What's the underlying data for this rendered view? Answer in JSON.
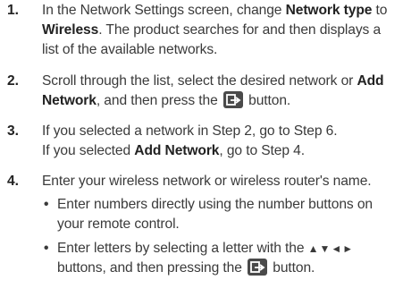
{
  "steps": [
    {
      "num": "1.",
      "p1": "In the Network Settings screen, change ",
      "b1": "Network type",
      "p2": " to ",
      "b2": "Wireless",
      "p3": ". The product searches for and then displays a list of the available networks."
    },
    {
      "num": "2.",
      "p1": "Scroll through the list, select the desired network or ",
      "b1": "Add Network",
      "p2": ", and then press the",
      "p3": "button."
    },
    {
      "num": "3.",
      "line1": "If you selected a network in Step 2, go to Step 6.",
      "p1": "If you selected ",
      "b1": "Add Network",
      "p2": ", go to Step 4."
    },
    {
      "num": "4.",
      "p1": "Enter your wireless network or wireless router's name.",
      "bullet1": "Enter numbers directly using the number buttons on your remote control.",
      "bullet2_a": "Enter letters by selecting a letter with the",
      "bullet2_arrows": "▲▼◄►",
      "bullet2_b": "buttons, and then pressing the",
      "bullet2_c": "button."
    }
  ],
  "bullet_char": "•",
  "icons": {
    "enter": "enter-button-icon"
  }
}
